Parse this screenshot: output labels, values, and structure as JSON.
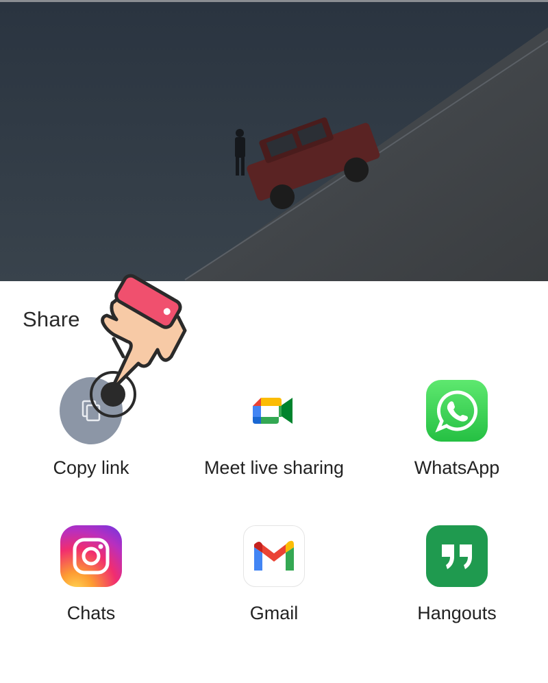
{
  "share_sheet": {
    "title": "Share",
    "row1": [
      {
        "label": "Copy link",
        "icon": "copy-icon"
      },
      {
        "label": "Meet live sharing",
        "icon": "google-meet-icon"
      },
      {
        "label": "WhatsApp",
        "icon": "whatsapp-icon"
      }
    ],
    "row2": [
      {
        "label": "Chats",
        "icon": "instagram-icon"
      },
      {
        "label": "Gmail",
        "icon": "gmail-icon"
      },
      {
        "label": "Hangouts",
        "icon": "hangouts-icon"
      }
    ]
  },
  "colors": {
    "copy_circle": "#8c96a6",
    "whatsapp": "#25c043",
    "hangouts": "#1f9a4f",
    "hand_cuff": "#f0506e"
  }
}
